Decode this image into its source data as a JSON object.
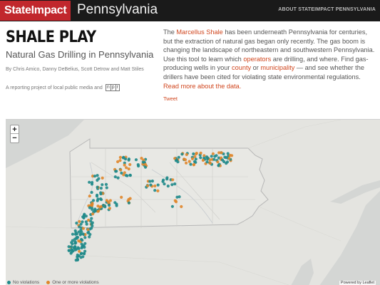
{
  "header": {
    "brand": "StateImpact",
    "state": "Pennsylvania",
    "about_link": "ABOUT STATEIMPACT PENNSYLVANIA"
  },
  "left": {
    "title": "SHALE PLAY",
    "subtitle": "Natural Gas Drilling in Pennsylvania",
    "byline": "By Chris Amico, Danny DeBelius, Scott Detrow and Matt Stiles",
    "project": "A reporting project of local public media and",
    "npr_letters": [
      "n",
      "p",
      "r"
    ]
  },
  "intro": {
    "t1": "The ",
    "link_marcellus": "Marcellus Shale",
    "t2": " has been underneath Pennsylvania for centuries, but the extraction of natural gas began only recently. The gas boom is changing the landscape of northeastern and southwestern Pennsylvania. Use this tool to learn which ",
    "link_operators": "operators",
    "t3": " are drilling, and where. Find gas-producing wells in your ",
    "link_county": "county",
    "t4": " or ",
    "link_municipality": "municipality",
    "t5": " — and see whether the drillers have been cited for violating state environmental regulations. ",
    "link_readmore": "Read more about the data.",
    "tweet": "Tweet"
  },
  "map": {
    "zoom_in": "+",
    "zoom_out": "−",
    "legend": {
      "no_violations": "No violations",
      "violations": "One or more violations"
    },
    "attribution": "Powered by Leaflet",
    "colors": {
      "no_violations": "#1f8a8a",
      "violations": "#e0862a",
      "land": "#e4e4e0",
      "water": "#d2d4d2"
    }
  }
}
